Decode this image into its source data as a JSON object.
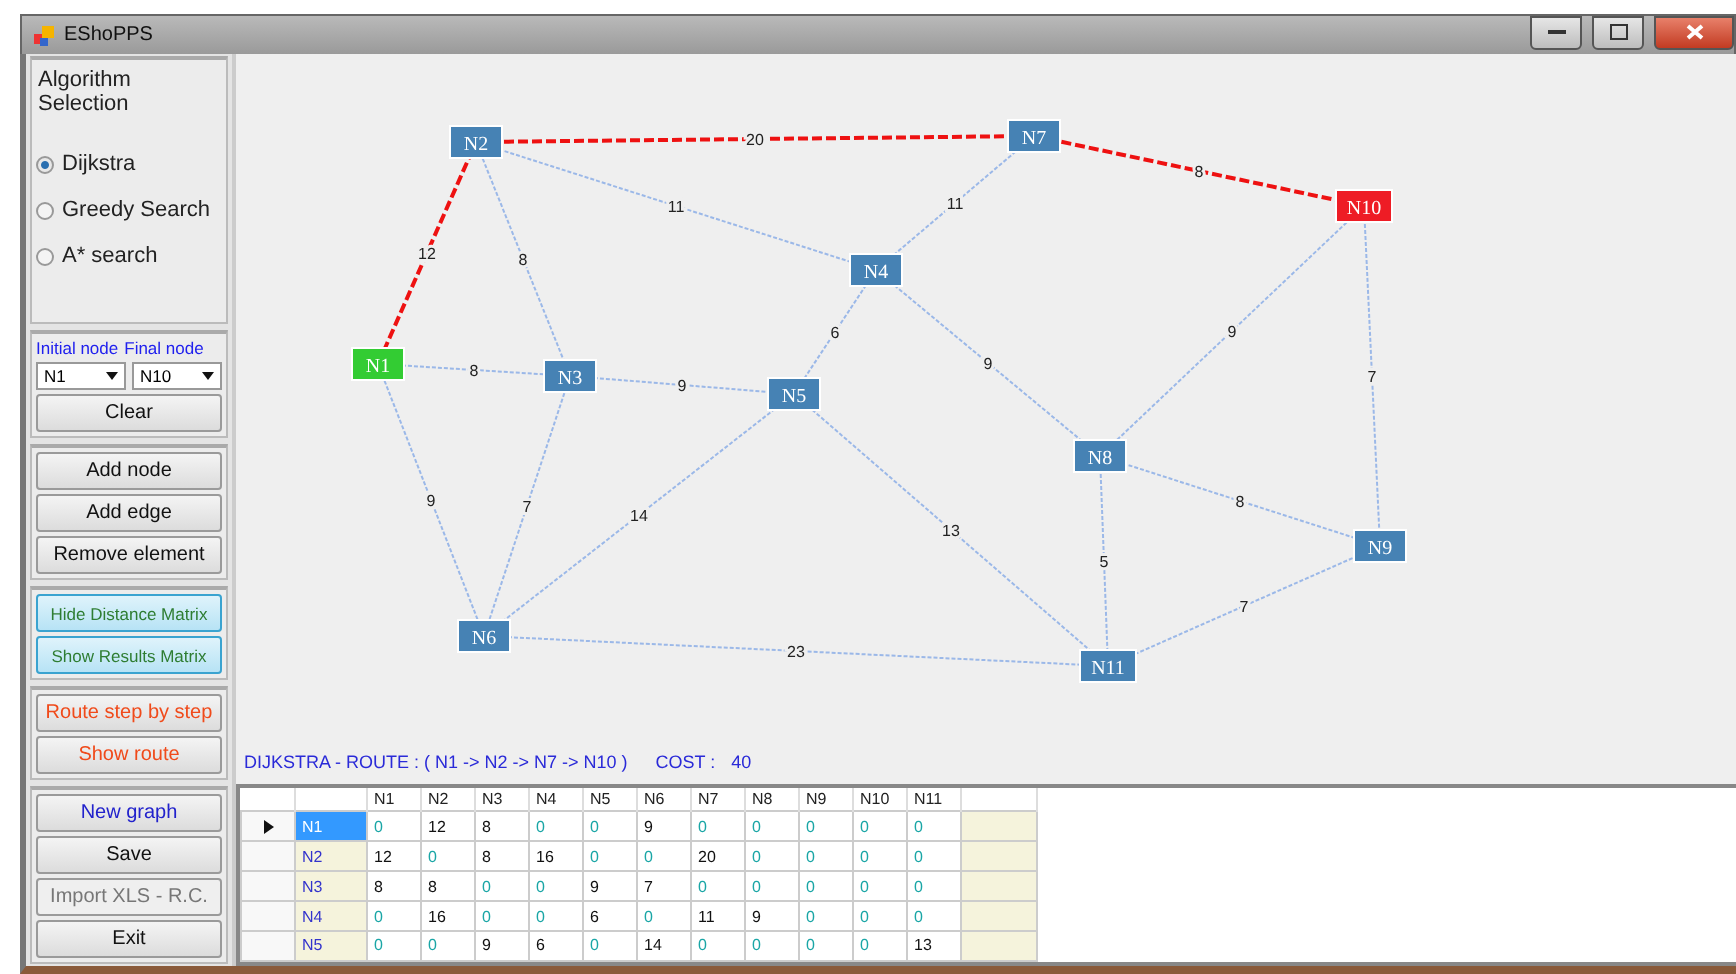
{
  "window": {
    "title": "EShoPPS"
  },
  "algorithm": {
    "title": "Algorithm Selection",
    "options": [
      {
        "label": "Dijkstra",
        "selected": true
      },
      {
        "label": "Greedy Search",
        "selected": false
      },
      {
        "label": "A* search",
        "selected": false
      }
    ]
  },
  "node_selection": {
    "initial_label": "Initial node",
    "final_label": "Final node",
    "initial_value": "N1",
    "final_value": "N10",
    "clear_button": "Clear"
  },
  "button_groups": [
    [
      {
        "label": "Add node",
        "kind": "plain",
        "disabled": false
      },
      {
        "label": "Add  edge",
        "kind": "plain",
        "disabled": false
      },
      {
        "label": "Remove element",
        "kind": "plain",
        "disabled": false
      }
    ],
    [
      {
        "label": "Hide Distance Matrix",
        "kind": "matrix",
        "disabled": false
      },
      {
        "label": "Show Results Matrix",
        "kind": "matrix",
        "disabled": false
      }
    ],
    [
      {
        "label": "Route step by step",
        "kind": "route",
        "disabled": false
      },
      {
        "label": "Show route",
        "kind": "route",
        "disabled": false
      }
    ],
    [
      {
        "label": "New graph",
        "kind": "file",
        "disabled": false
      },
      {
        "label": "Save",
        "kind": "plain",
        "disabled": false
      },
      {
        "label": "Import XLS - R.C.",
        "kind": "plain",
        "disabled": true
      },
      {
        "label": "Exit",
        "kind": "plain",
        "disabled": false
      }
    ]
  ],
  "graph": {
    "nodes": [
      {
        "label": "N1",
        "kind": "start"
      },
      {
        "label": "N2",
        "kind": "normal"
      },
      {
        "label": "N3",
        "kind": "normal"
      },
      {
        "label": "N4",
        "kind": "normal"
      },
      {
        "label": "N5",
        "kind": "normal"
      },
      {
        "label": "N6",
        "kind": "normal"
      },
      {
        "label": "N7",
        "kind": "normal"
      },
      {
        "label": "N8",
        "kind": "normal"
      },
      {
        "label": "N9",
        "kind": "normal"
      },
      {
        "label": "N10",
        "kind": "end"
      },
      {
        "label": "N11",
        "kind": "normal"
      }
    ],
    "edges": [
      {
        "weight": "12",
        "on_route": true
      },
      {
        "weight": "20",
        "on_route": true
      },
      {
        "weight": "8",
        "on_route": true
      },
      {
        "weight": "8",
        "on_route": false
      },
      {
        "weight": "11",
        "on_route": false
      },
      {
        "weight": "11",
        "on_route": false
      },
      {
        "weight": "8",
        "on_route": false
      },
      {
        "weight": "9",
        "on_route": false
      },
      {
        "weight": "6",
        "on_route": false
      },
      {
        "weight": "9",
        "on_route": false
      },
      {
        "weight": "9",
        "on_route": false
      },
      {
        "weight": "7",
        "on_route": false
      },
      {
        "weight": "9",
        "on_route": false
      },
      {
        "weight": "7",
        "on_route": false
      },
      {
        "weight": "14",
        "on_route": false
      },
      {
        "weight": "13",
        "on_route": false
      },
      {
        "weight": "5",
        "on_route": false
      },
      {
        "weight": "8",
        "on_route": false
      },
      {
        "weight": "7",
        "on_route": false
      },
      {
        "weight": "23",
        "on_route": false
      }
    ]
  },
  "result": {
    "route": "DIJKSTRA - ROUTE : ( N1  ->  N2  ->  N7  ->  N10 )",
    "cost_label": "COST :",
    "cost": "40"
  },
  "matrix": {
    "columns": [
      "N1",
      "N2",
      "N3",
      "N4",
      "N5",
      "N6",
      "N7",
      "N8",
      "N9",
      "N10",
      "N11"
    ],
    "rows": [
      {
        "header": "N1",
        "current": true,
        "selected": true,
        "cells": [
          "0",
          "12",
          "8",
          "0",
          "0",
          "9",
          "0",
          "0",
          "0",
          "0",
          "0"
        ]
      },
      {
        "header": "N2",
        "current": false,
        "selected": false,
        "cells": [
          "12",
          "0",
          "8",
          "16",
          "0",
          "0",
          "20",
          "0",
          "0",
          "0",
          "0"
        ]
      },
      {
        "header": "N3",
        "current": false,
        "selected": false,
        "cells": [
          "8",
          "8",
          "0",
          "0",
          "9",
          "7",
          "0",
          "0",
          "0",
          "0",
          "0"
        ]
      },
      {
        "header": "N4",
        "current": false,
        "selected": false,
        "cells": [
          "0",
          "16",
          "0",
          "0",
          "6",
          "0",
          "11",
          "9",
          "0",
          "0",
          "0"
        ]
      },
      {
        "header": "N5",
        "current": false,
        "selected": false,
        "cells": [
          "0",
          "0",
          "9",
          "6",
          "0",
          "14",
          "0",
          "0",
          "0",
          "0",
          "13"
        ]
      }
    ]
  }
}
